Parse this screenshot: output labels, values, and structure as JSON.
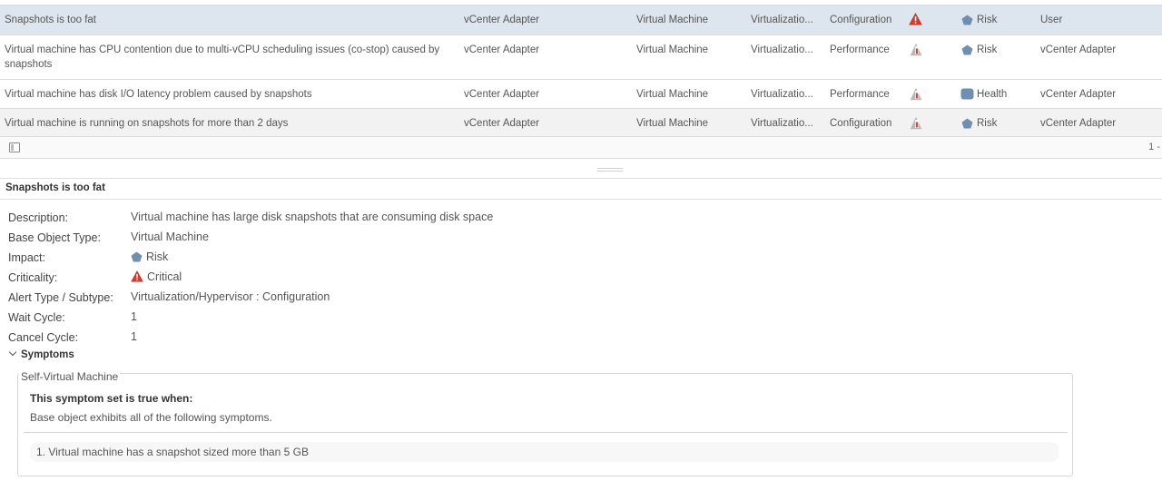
{
  "grid": {
    "rows": [
      {
        "name": "Snapshots is too fat",
        "adapter": "vCenter Adapter",
        "object_type": "Virtual Machine",
        "alert_type": "Virtualizatio...",
        "subtype": "Configuration",
        "criticality_icon": "critical-triangle-icon",
        "impact_icon": "risk-pentagon-icon",
        "impact": "Risk",
        "defined_by": "User"
      },
      {
        "name": "Virtual machine has CPU contention due to multi-vCPU scheduling issues (co-stop) caused by snapshots",
        "adapter": "vCenter Adapter",
        "object_type": "Virtual Machine",
        "alert_type": "Virtualizatio...",
        "subtype": "Performance",
        "criticality_icon": "symptom-based-icon",
        "impact_icon": "risk-pentagon-icon",
        "impact": "Risk",
        "defined_by": "vCenter Adapter"
      },
      {
        "name": "Virtual machine has disk I/O latency problem caused by snapshots",
        "adapter": "vCenter Adapter",
        "object_type": "Virtual Machine",
        "alert_type": "Virtualizatio...",
        "subtype": "Performance",
        "criticality_icon": "symptom-based-icon",
        "impact_icon": "health-icon",
        "impact": "Health",
        "defined_by": "vCenter Adapter"
      },
      {
        "name": "Virtual machine is running on snapshots for more than 2 days",
        "adapter": "vCenter Adapter",
        "object_type": "Virtual Machine",
        "alert_type": "Virtualizatio...",
        "subtype": "Configuration",
        "criticality_icon": "symptom-based-icon",
        "impact_icon": "risk-pentagon-icon",
        "impact": "Risk",
        "defined_by": "vCenter Adapter"
      }
    ],
    "footer": {
      "pagination": "1 -"
    }
  },
  "details": {
    "title": "Snapshots is too fat",
    "labels": {
      "description": "Description:",
      "base_object_type": "Base Object Type:",
      "impact": "Impact:",
      "criticality": "Criticality:",
      "alert_type": "Alert Type / Subtype:",
      "wait_cycle": "Wait Cycle:",
      "cancel_cycle": "Cancel Cycle:"
    },
    "values": {
      "description": "Virtual machine has large disk snapshots that are consuming disk space",
      "base_object_type": "Virtual Machine",
      "impact": "Risk",
      "criticality": "Critical",
      "alert_type": "Virtualization/Hypervisor : Configuration",
      "wait_cycle": "1",
      "cancel_cycle": "1"
    },
    "symptoms": {
      "toggle_label": "Symptoms",
      "legend": "Self-Virtual Machine",
      "heading": "This symptom set is true when:",
      "sub": "Base object exhibits all of the following symptoms.",
      "items": [
        "1. Virtual machine has a snapshot sized more than 5 GB"
      ]
    }
  },
  "colors": {
    "selected_row": "#dde6ee",
    "critical_red": "#d93a2b",
    "risk_blue": "#6f8fb0"
  }
}
